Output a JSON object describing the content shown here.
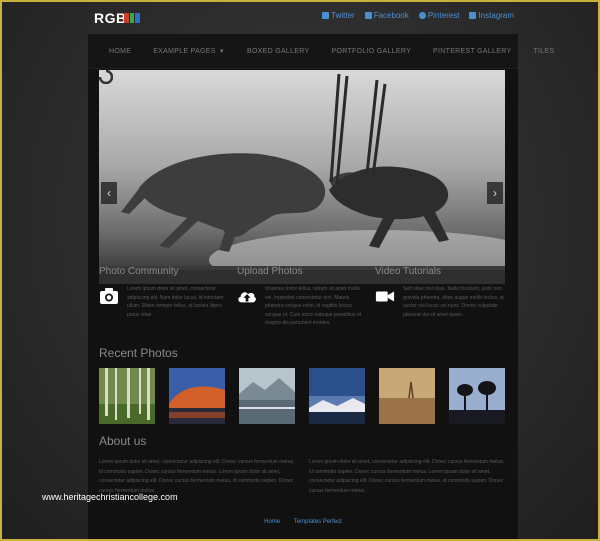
{
  "logo": {
    "text": "RGB",
    "bar_colors": [
      "#d23a2a",
      "#3aa83a",
      "#2a6fd2"
    ]
  },
  "social": {
    "twitter": "Twitter",
    "facebook": "Facebook",
    "pinterest": "Pinterest",
    "instagram": "Instagram"
  },
  "nav": {
    "items": [
      "HOME",
      "EXAMPLE PAGES",
      "BOXED GALLERY",
      "PORTFOLIO GALLERY",
      "PINTEREST GALLERY",
      "TILES"
    ]
  },
  "hero": {
    "prev": "‹",
    "next": "›"
  },
  "columns": [
    {
      "title": "Photo Community",
      "icon": "camera-icon",
      "text": "Lorem ipsum dolor sit amet, consectetur adipiscing elit. Nam dolor lacus, id interdum ullum. Etiam semper tellus, at lacinia libero purus vitae."
    },
    {
      "title": "Upload Photos",
      "icon": "cloud-upload-icon",
      "text": "Vivamus tortor tellus, rutrum sit amet mollis vel, imperdiet consectetur orci. Mauris pharetra congue enim, id sagittis lectus congue ut. Cum socis natoque penatibus et magnis dis parturient montes."
    },
    {
      "title": "Video Tutorials",
      "icon": "video-camera-icon",
      "text": "Sed vitae nisl risus. Nulla tincidunt, justo non gravida pharetra, diam augue mollis lectus, at auctor nisi lacus vel nunc. Donec vulputate placerat dui sit amet quam."
    }
  ],
  "recent": {
    "title": "Recent Photos"
  },
  "about": {
    "title": "About us",
    "left": "Lorem ipsum dolor sit amet, consectetur adipiscing elit. Donec cursus fermentum metus, id commodo sapien. Donec cursus fermentum metus. Lorem ipsum dolor sit amet, consectetur adipiscing elit. Donec cursus fermentum metus, id commodo sapien. Donec cursus fermentum metus.",
    "right": "Lorem ipsum dolor sit amet, consectetur adipiscing elit. Donec cursus fermentum metus, id commodo sapien. Donec cursus fermentum metus. Lorem ipsum dolor sit amet, consectetur adipiscing elit. Donec cursus fermentum metus, id commodo sapien. Donec cursus fermentum metus."
  },
  "footer": {
    "home": "Home",
    "credit": "Templates Perfect"
  },
  "watermark": "www.heritagechristiancollege.com"
}
